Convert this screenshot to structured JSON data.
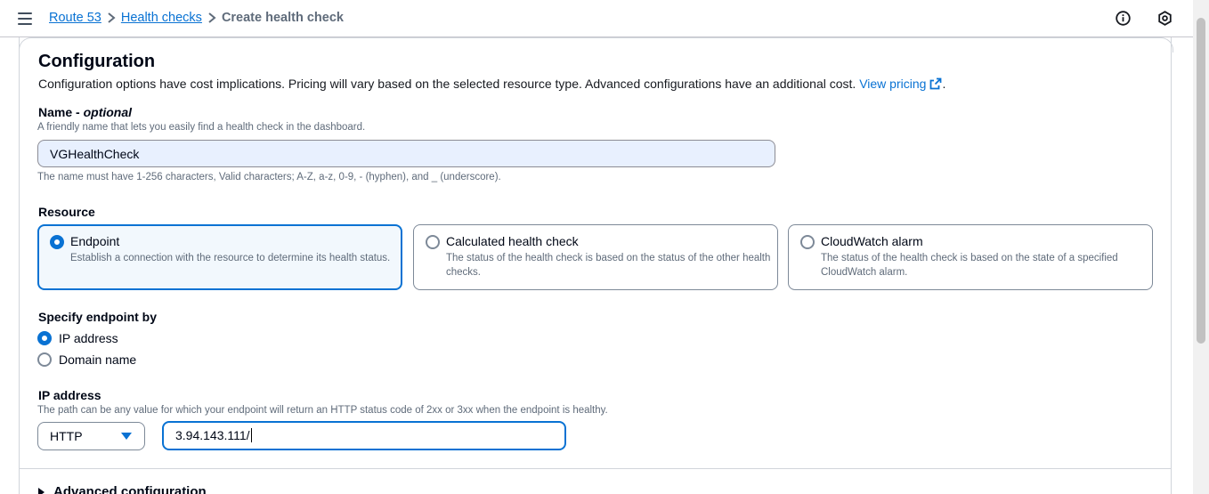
{
  "breadcrumb": {
    "items": [
      "Route 53",
      "Health checks"
    ],
    "current": "Create health check",
    "separator": ">"
  },
  "configuration": {
    "title": "Configuration",
    "description": "Configuration options have cost implications. Pricing will vary based on the selected resource type. Advanced configurations have an additional cost.",
    "link_text": "View pricing",
    "link_suffix": ".",
    "name": {
      "label": "Name",
      "optional": "optional",
      "hint": "A friendly name that lets you easily find a health check in the dashboard.",
      "value": "VGHealthCheck",
      "constraint": "The name must have 1-256 characters, Valid characters; A-Z, a-z, 0-9, - (hyphen), and _ (underscore)."
    },
    "resource": {
      "label": "Resource",
      "options": [
        {
          "title": "Endpoint",
          "description": "Establish a connection with the resource to determine its health status.",
          "selected": true
        },
        {
          "title": "Calculated health check",
          "description": "The status of the health check is based on the status of the other health checks.",
          "selected": false
        },
        {
          "title": "CloudWatch alarm",
          "description": "The status of the health check is based on the state of a specified CloudWatch alarm.",
          "selected": false
        }
      ]
    },
    "specify_endpoint": {
      "label": "Specify endpoint by",
      "options": [
        {
          "label": "IP address",
          "selected": true
        },
        {
          "label": "Domain name",
          "selected": false
        }
      ]
    },
    "ip_address": {
      "label": "IP address",
      "hint": "The path can be any value for which your endpoint will return an HTTP status code of 2xx or 3xx when the endpoint is healthy.",
      "protocol": "HTTP",
      "value": "3.94.143.111/"
    },
    "advanced": "Advanced configuration"
  },
  "colors": {
    "accent": "#0972d3",
    "text": "#000716",
    "secondary_text": "#5f6b7a",
    "autofill_bg": "#e8f0fe"
  }
}
